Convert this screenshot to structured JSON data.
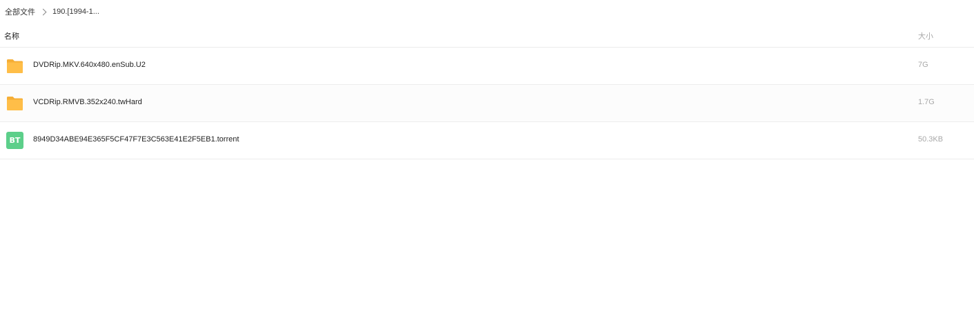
{
  "breadcrumb": {
    "root": "全部文件",
    "current": "190.[1994-1..."
  },
  "list_header": {
    "name_column": "名称",
    "size_column": "大小"
  },
  "colors": {
    "folder": "#FFBE48",
    "bt_badge": "#5CCF8A",
    "secondary_text": "#A8A8A8",
    "divider": "#ECECEC"
  },
  "files": [
    {
      "icon": "folder-icon",
      "name": "DVDRip.MKV.640x480.enSub.U2",
      "size": "7G"
    },
    {
      "icon": "folder-icon",
      "name": "VCDRip.RMVB.352x240.twHard",
      "size": "1.7G"
    },
    {
      "icon": "bt-torrent-icon",
      "icon_label": "BT",
      "name": "8949D34ABE94E365F5CF47F7E3C563E41E2F5EB1.torrent",
      "size": "50.3KB"
    }
  ]
}
